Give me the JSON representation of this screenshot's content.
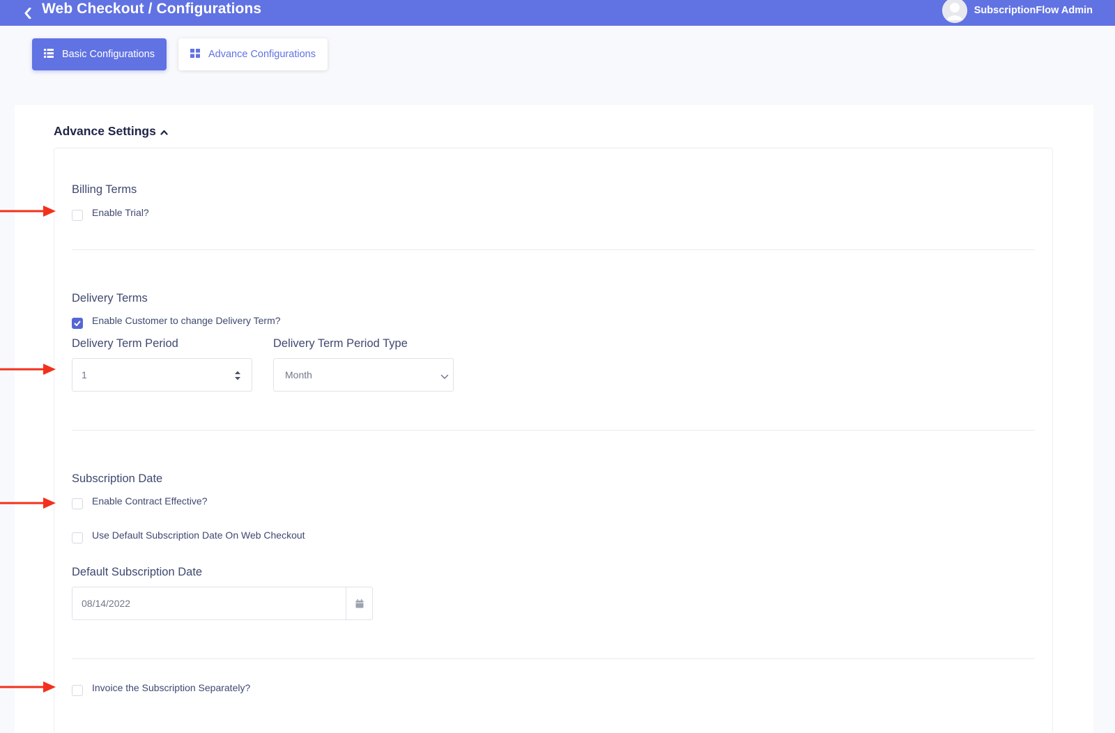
{
  "header": {
    "title": "Web Checkout / Configurations",
    "user_name": "SubscriptionFlow Admin"
  },
  "tabs": [
    {
      "label": "Basic Configurations",
      "active": true,
      "icon": "list-icon"
    },
    {
      "label": "Advance Configurations",
      "active": false,
      "icon": "grid-icon"
    }
  ],
  "advance_settings": {
    "title": "Advance Settings",
    "billing_terms": {
      "title": "Billing Terms",
      "enable_trial": {
        "label": "Enable Trial?",
        "checked": false
      }
    },
    "delivery_terms": {
      "title": "Delivery Terms",
      "enable_change": {
        "label": "Enable Customer to change Delivery Term?",
        "checked": true
      },
      "period_label": "Delivery Term Period",
      "period_value": "1",
      "period_type_label": "Delivery Term Period Type",
      "period_type_value": "Month"
    },
    "subscription_date": {
      "title": "Subscription Date",
      "enable_contract_effective": {
        "label": "Enable Contract Effective?",
        "checked": false
      },
      "use_default_date": {
        "label": "Use Default Subscription Date On Web Checkout",
        "checked": false
      },
      "default_date_label": "Default Subscription Date",
      "default_date_value": "08/14/2022"
    },
    "invoice_separately": {
      "label": "Invoice the Subscription Separately?",
      "checked": false
    }
  },
  "colors": {
    "primary": "#6172e3",
    "annotation_arrow": "#f2311c"
  }
}
